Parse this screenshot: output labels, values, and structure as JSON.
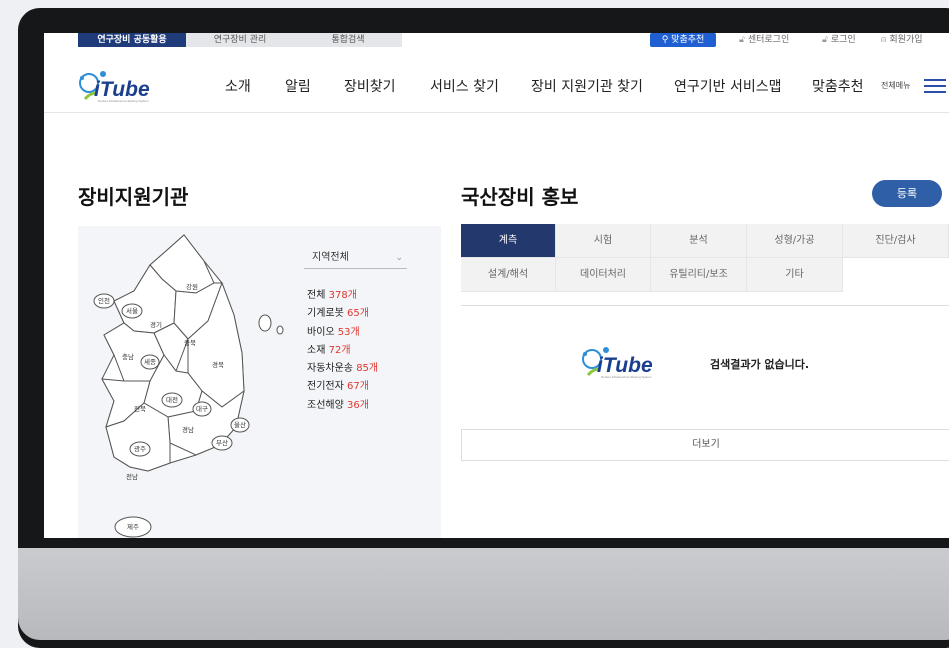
{
  "top_tabs": [
    {
      "label": "연구장비 공동활용",
      "active": true
    },
    {
      "label": "연구장비 관리",
      "active": false
    },
    {
      "label": "통합검색",
      "active": false
    }
  ],
  "utility": {
    "recommend": "맞춤추천",
    "center_login": "센터로그인",
    "login": "로그인",
    "signup": "회원가입"
  },
  "logo": {
    "text": "iTube",
    "tagline": "Nurture Infrastructure Sharing System"
  },
  "nav": [
    "소개",
    "알림",
    "장비찾기",
    "서비스 찾기",
    "장비 지원기관 찾기",
    "연구기반 서비스맵",
    "맞춤추천"
  ],
  "all_menu": "전체메뉴",
  "left_section": {
    "title": "장비지원기관",
    "region_select": "지역전체",
    "regions": [
      "강원",
      "인천",
      "서울",
      "경기",
      "충북",
      "충남",
      "세종",
      "경북",
      "대전",
      "전북",
      "대구",
      "울산",
      "경남",
      "광주",
      "부산",
      "전남",
      "제주"
    ],
    "categories": [
      {
        "name": "전체",
        "count": "378개"
      },
      {
        "name": "기계로봇",
        "count": "65개"
      },
      {
        "name": "바이오",
        "count": "53개"
      },
      {
        "name": "소재",
        "count": "72개"
      },
      {
        "name": "자동차운송",
        "count": "85개"
      },
      {
        "name": "전기전자",
        "count": "67개"
      },
      {
        "name": "조선해양",
        "count": "36개"
      }
    ]
  },
  "right_section": {
    "title": "국산장비 홍보",
    "register": "등록",
    "tabs_row1": [
      "계측",
      "시험",
      "분석",
      "성형/가공",
      "진단/검사"
    ],
    "tabs_row2": [
      "설계/해석",
      "데이터처리",
      "유틸리티/보조",
      "기타"
    ],
    "active_tab": "계측",
    "no_result": "검색결과가 없습니다.",
    "more": "더보기"
  },
  "colors": {
    "navy": "#1f3b7a",
    "tab_active": "#23386d",
    "accent": "#1f5fd1",
    "count_red": "#e2362f",
    "register": "#2f5fa6"
  }
}
